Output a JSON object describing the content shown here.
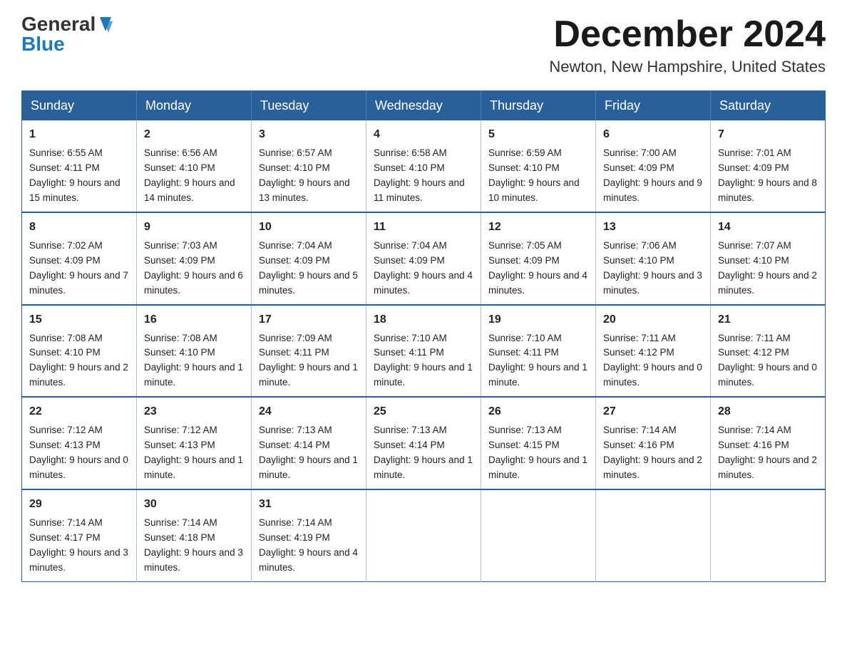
{
  "logo": {
    "general": "General",
    "blue": "Blue"
  },
  "title": {
    "month": "December 2024",
    "location": "Newton, New Hampshire, United States"
  },
  "header": {
    "days": [
      "Sunday",
      "Monday",
      "Tuesday",
      "Wednesday",
      "Thursday",
      "Friday",
      "Saturday"
    ]
  },
  "weeks": [
    [
      {
        "day": "1",
        "sunrise": "6:55 AM",
        "sunset": "4:11 PM",
        "daylight": "9 hours and 15 minutes."
      },
      {
        "day": "2",
        "sunrise": "6:56 AM",
        "sunset": "4:10 PM",
        "daylight": "9 hours and 14 minutes."
      },
      {
        "day": "3",
        "sunrise": "6:57 AM",
        "sunset": "4:10 PM",
        "daylight": "9 hours and 13 minutes."
      },
      {
        "day": "4",
        "sunrise": "6:58 AM",
        "sunset": "4:10 PM",
        "daylight": "9 hours and 11 minutes."
      },
      {
        "day": "5",
        "sunrise": "6:59 AM",
        "sunset": "4:10 PM",
        "daylight": "9 hours and 10 minutes."
      },
      {
        "day": "6",
        "sunrise": "7:00 AM",
        "sunset": "4:09 PM",
        "daylight": "9 hours and 9 minutes."
      },
      {
        "day": "7",
        "sunrise": "7:01 AM",
        "sunset": "4:09 PM",
        "daylight": "9 hours and 8 minutes."
      }
    ],
    [
      {
        "day": "8",
        "sunrise": "7:02 AM",
        "sunset": "4:09 PM",
        "daylight": "9 hours and 7 minutes."
      },
      {
        "day": "9",
        "sunrise": "7:03 AM",
        "sunset": "4:09 PM",
        "daylight": "9 hours and 6 minutes."
      },
      {
        "day": "10",
        "sunrise": "7:04 AM",
        "sunset": "4:09 PM",
        "daylight": "9 hours and 5 minutes."
      },
      {
        "day": "11",
        "sunrise": "7:04 AM",
        "sunset": "4:09 PM",
        "daylight": "9 hours and 4 minutes."
      },
      {
        "day": "12",
        "sunrise": "7:05 AM",
        "sunset": "4:09 PM",
        "daylight": "9 hours and 4 minutes."
      },
      {
        "day": "13",
        "sunrise": "7:06 AM",
        "sunset": "4:10 PM",
        "daylight": "9 hours and 3 minutes."
      },
      {
        "day": "14",
        "sunrise": "7:07 AM",
        "sunset": "4:10 PM",
        "daylight": "9 hours and 2 minutes."
      }
    ],
    [
      {
        "day": "15",
        "sunrise": "7:08 AM",
        "sunset": "4:10 PM",
        "daylight": "9 hours and 2 minutes."
      },
      {
        "day": "16",
        "sunrise": "7:08 AM",
        "sunset": "4:10 PM",
        "daylight": "9 hours and 1 minute."
      },
      {
        "day": "17",
        "sunrise": "7:09 AM",
        "sunset": "4:11 PM",
        "daylight": "9 hours and 1 minute."
      },
      {
        "day": "18",
        "sunrise": "7:10 AM",
        "sunset": "4:11 PM",
        "daylight": "9 hours and 1 minute."
      },
      {
        "day": "19",
        "sunrise": "7:10 AM",
        "sunset": "4:11 PM",
        "daylight": "9 hours and 1 minute."
      },
      {
        "day": "20",
        "sunrise": "7:11 AM",
        "sunset": "4:12 PM",
        "daylight": "9 hours and 0 minutes."
      },
      {
        "day": "21",
        "sunrise": "7:11 AM",
        "sunset": "4:12 PM",
        "daylight": "9 hours and 0 minutes."
      }
    ],
    [
      {
        "day": "22",
        "sunrise": "7:12 AM",
        "sunset": "4:13 PM",
        "daylight": "9 hours and 0 minutes."
      },
      {
        "day": "23",
        "sunrise": "7:12 AM",
        "sunset": "4:13 PM",
        "daylight": "9 hours and 1 minute."
      },
      {
        "day": "24",
        "sunrise": "7:13 AM",
        "sunset": "4:14 PM",
        "daylight": "9 hours and 1 minute."
      },
      {
        "day": "25",
        "sunrise": "7:13 AM",
        "sunset": "4:14 PM",
        "daylight": "9 hours and 1 minute."
      },
      {
        "day": "26",
        "sunrise": "7:13 AM",
        "sunset": "4:15 PM",
        "daylight": "9 hours and 1 minute."
      },
      {
        "day": "27",
        "sunrise": "7:14 AM",
        "sunset": "4:16 PM",
        "daylight": "9 hours and 2 minutes."
      },
      {
        "day": "28",
        "sunrise": "7:14 AM",
        "sunset": "4:16 PM",
        "daylight": "9 hours and 2 minutes."
      }
    ],
    [
      {
        "day": "29",
        "sunrise": "7:14 AM",
        "sunset": "4:17 PM",
        "daylight": "9 hours and 3 minutes."
      },
      {
        "day": "30",
        "sunrise": "7:14 AM",
        "sunset": "4:18 PM",
        "daylight": "9 hours and 3 minutes."
      },
      {
        "day": "31",
        "sunrise": "7:14 AM",
        "sunset": "4:19 PM",
        "daylight": "9 hours and 4 minutes."
      },
      null,
      null,
      null,
      null
    ]
  ],
  "labels": {
    "sunrise": "Sunrise: ",
    "sunset": "Sunset: ",
    "daylight": "Daylight: "
  }
}
